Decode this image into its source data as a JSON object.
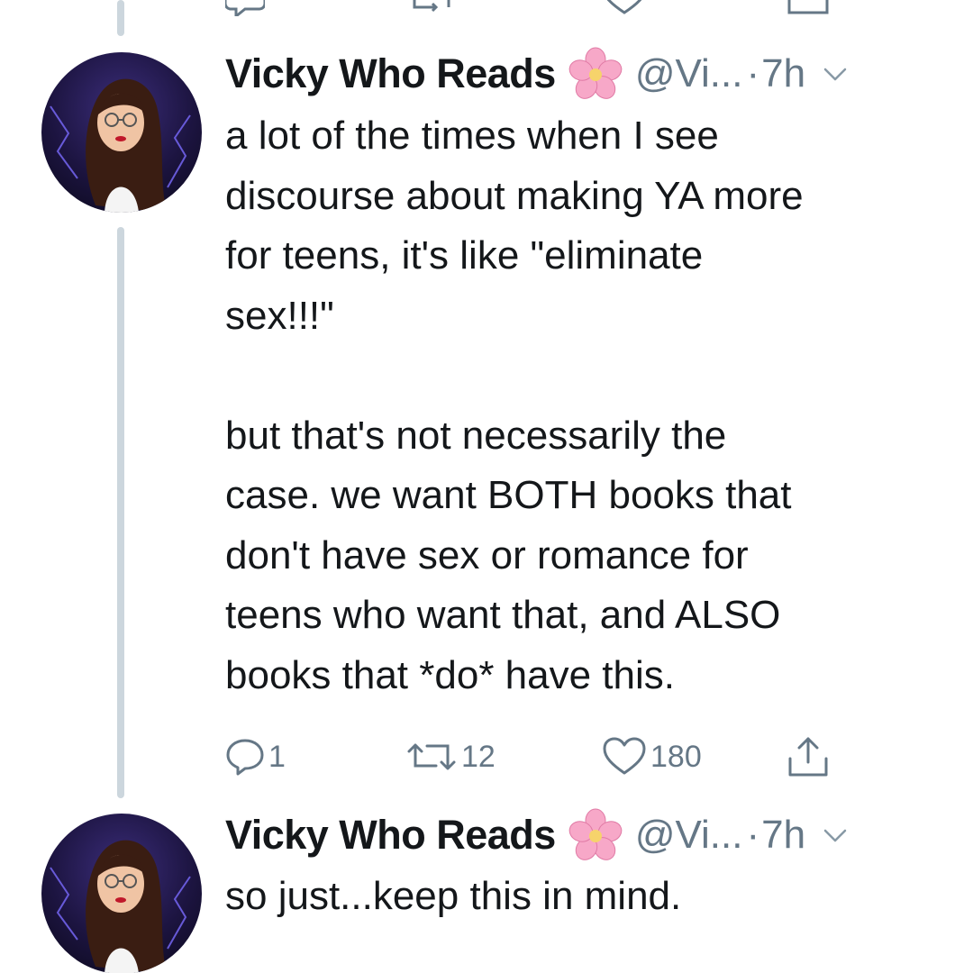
{
  "colors": {
    "text_primary": "#14171a",
    "text_secondary": "#657786",
    "thread_line": "#ccd6dd",
    "avatar_background": "#1c1440",
    "flower_pink": "#f7a8c8"
  },
  "tweets": [
    {
      "display_name": "Vicky Who Reads",
      "name_emoji": "cherry-blossom-emoji",
      "handle": "@Vi...",
      "separator": "·",
      "time": "7h",
      "text": "a lot of the times when I see\ndiscourse about making YA more\nfor teens, it's like \"eliminate\nsex!!!\"\n\nbut that's not necessarily the\ncase. we want BOTH books that\ndon't have sex or romance for\nteens who want that, and ALSO\nbooks that *do* have this.",
      "actions": {
        "reply_count": "1",
        "retweet_count": "12",
        "like_count": "180"
      }
    },
    {
      "display_name": "Vicky Who Reads",
      "name_emoji": "cherry-blossom-emoji",
      "handle": "@Vi...",
      "separator": "·",
      "time": "7h",
      "text": "so just...keep this in mind."
    }
  ]
}
